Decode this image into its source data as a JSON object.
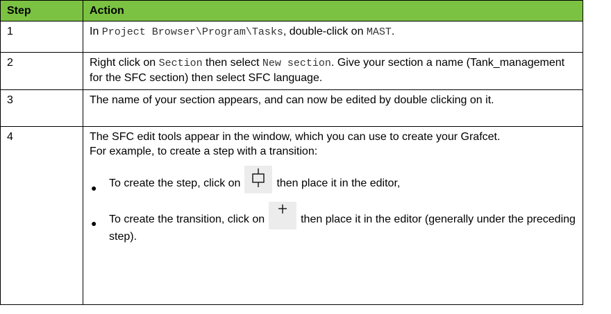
{
  "table": {
    "headers": {
      "step": "Step",
      "action": "Action"
    },
    "rows": [
      {
        "step": "1",
        "action": {
          "pre": "In ",
          "path": "Project Browser\\Program\\Tasks",
          "mid": ", double-click on ",
          "task": "MAST",
          "post": "."
        }
      },
      {
        "step": "2",
        "action": {
          "pre": "Right click on ",
          "item": "Section",
          "mid": " then select ",
          "menu": "New section",
          "post": ". Give your section a name (Tank_management for the SFC section) then select SFC language."
        }
      },
      {
        "step": "3",
        "action": "The name of your section appears, and can now be edited by double clicking on it."
      },
      {
        "step": "4",
        "action": {
          "intro": "The SFC edit tools appear in the window, which you can use to create your Grafcet.",
          "example": "For example, to create a step with a transition:",
          "bullet1": {
            "pre": "To create the step, click on",
            "icon": "sfc-step-tool-icon",
            "post": "then place it in the editor,"
          },
          "bullet2": {
            "pre": "To create the transition, click on",
            "icon": "sfc-transition-tool-icon",
            "post": "then place it in the editor (generally under the preceding step)."
          }
        }
      }
    ]
  },
  "colors": {
    "header_background": "#7cc242",
    "border": "#000000",
    "monospace_text": "#333333"
  }
}
